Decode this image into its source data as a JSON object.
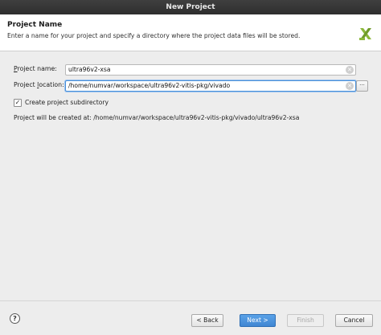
{
  "window": {
    "title": "New Project"
  },
  "banner": {
    "title": "Project Name",
    "subtitle": "Enter a name for your project and specify a directory where the project data files will be stored.",
    "logo_icon": "xilinx-logo-icon"
  },
  "form": {
    "name_label_prefix": "P",
    "name_label_rest": "roject name:",
    "name_value": "ultra96v2-xsa",
    "location_label_prefix": "Project ",
    "location_label_u": "l",
    "location_label_rest": "ocation:",
    "location_value": "/home/numvar/workspace/ultra96v2-vitis-pkg/vivado",
    "browse_label": "···",
    "subdir_checked": true,
    "subdir_label": "Create project subdirectory",
    "created_at_text": "Project will be created at: /home/numvar/workspace/ultra96v2-vitis-pkg/vivado/ultra96v2-xsa"
  },
  "footer": {
    "help_label": "?",
    "back_label": "< Back",
    "next_label": "Next >",
    "finish_label": "Finish",
    "cancel_label": "Cancel"
  },
  "colors": {
    "accent": "#3f86d2",
    "logo_green": "#8bb83a"
  }
}
